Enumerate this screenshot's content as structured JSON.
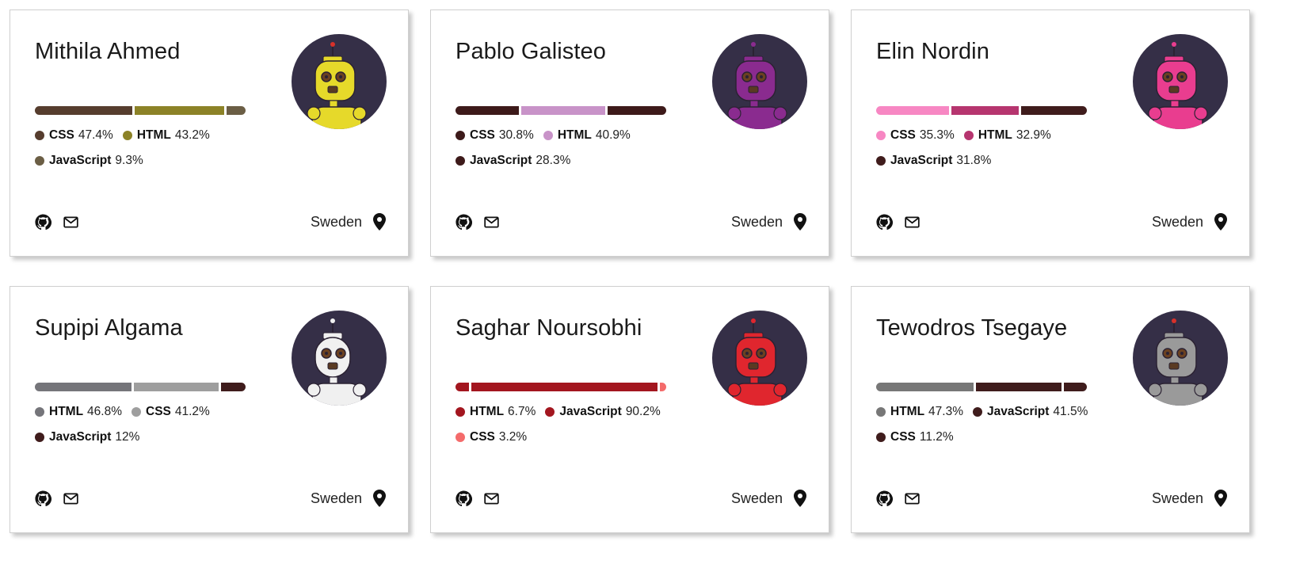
{
  "cards": [
    {
      "name": "Mithila Ahmed",
      "avatar": "yellow-robot",
      "avatar_color": "#e6d92a",
      "languages": [
        {
          "name": "CSS",
          "percent": 47.4,
          "label": "47.4%",
          "color": "#563d2e"
        },
        {
          "name": "HTML",
          "percent": 43.2,
          "label": "43.2%",
          "color": "#8c8227"
        },
        {
          "name": "JavaScript",
          "percent": 9.3,
          "label": "9.3%",
          "color": "#6b5e45"
        }
      ],
      "country": "Sweden"
    },
    {
      "name": "Pablo Galisteo",
      "avatar": "purple-robot",
      "avatar_color": "#8a2b8f",
      "languages": [
        {
          "name": "CSS",
          "percent": 30.8,
          "label": "30.8%",
          "color": "#3d1a1a"
        },
        {
          "name": "HTML",
          "percent": 40.9,
          "label": "40.9%",
          "color": "#c893c8"
        },
        {
          "name": "JavaScript",
          "percent": 28.3,
          "label": "28.3%",
          "color": "#3d1a1a"
        }
      ],
      "country": "Sweden"
    },
    {
      "name": "Elin Nordin",
      "avatar": "pink-robot",
      "avatar_color": "#e93d8f",
      "languages": [
        {
          "name": "CSS",
          "percent": 35.3,
          "label": "35.3%",
          "color": "#f787c3"
        },
        {
          "name": "HTML",
          "percent": 32.9,
          "label": "32.9%",
          "color": "#b6356f"
        },
        {
          "name": "JavaScript",
          "percent": 31.8,
          "label": "31.8%",
          "color": "#3f1c1c"
        }
      ],
      "country": "Sweden"
    },
    {
      "name": "Supipi Algama",
      "avatar": "white-robot",
      "avatar_color": "#f0f0f0",
      "languages": [
        {
          "name": "HTML",
          "percent": 46.8,
          "label": "46.8%",
          "color": "#75757a"
        },
        {
          "name": "CSS",
          "percent": 41.2,
          "label": "41.2%",
          "color": "#9e9e9e"
        },
        {
          "name": "JavaScript",
          "percent": 12,
          "label": "12%",
          "color": "#3f1c1c"
        }
      ],
      "country": "Sweden"
    },
    {
      "name": "Saghar Noursobhi",
      "avatar": "red-robot",
      "avatar_color": "#e0262e",
      "languages": [
        {
          "name": "HTML",
          "percent": 6.7,
          "label": "6.7%",
          "color": "#a3161f"
        },
        {
          "name": "JavaScript",
          "percent": 90.2,
          "label": "90.2%",
          "color": "#a3161f"
        },
        {
          "name": "CSS",
          "percent": 3.2,
          "label": "3.2%",
          "color": "#f46b6b"
        }
      ],
      "country": "Sweden"
    },
    {
      "name": "Tewodros Tsegaye",
      "avatar": "grey-robot",
      "avatar_color": "#9a9a9a",
      "languages": [
        {
          "name": "HTML",
          "percent": 47.3,
          "label": "47.3%",
          "color": "#777777"
        },
        {
          "name": "JavaScript",
          "percent": 41.5,
          "label": "41.5%",
          "color": "#3f1c1c"
        },
        {
          "name": "CSS",
          "percent": 11.2,
          "label": "11.2%",
          "color": "#3f1c1c"
        }
      ],
      "country": "Sweden"
    }
  ],
  "icons": {
    "github": "github-icon",
    "mail": "mail-icon",
    "location": "location-pin-icon"
  }
}
